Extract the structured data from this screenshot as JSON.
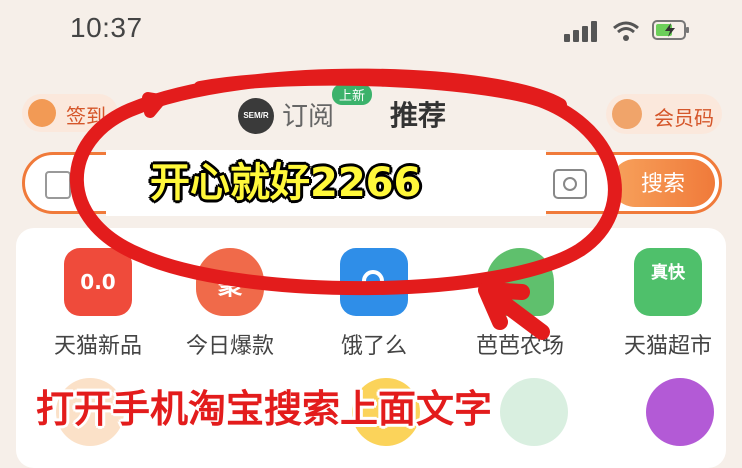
{
  "status_bar": {
    "time": "10:37"
  },
  "header": {
    "sign_in_label": "签到",
    "subscribe_tab": {
      "logo_text": "SEM/R",
      "label": "订阅",
      "badge": "上新"
    },
    "recommend_tab": "推荐",
    "member_code_label": "会员码"
  },
  "search": {
    "hint_overlay": "开心就好2266",
    "button_label": "搜索"
  },
  "quick_entries": [
    {
      "label": "天猫新品",
      "icon": "tmall-new-icon",
      "glyph": "0.0"
    },
    {
      "label": "今日爆款",
      "icon": "hot-deal-icon",
      "glyph": "聚"
    },
    {
      "label": "饿了么",
      "icon": "eleme-icon",
      "glyph": ""
    },
    {
      "label": "芭芭农场",
      "icon": "farm-icon",
      "glyph": ""
    },
    {
      "label": "天猫超市",
      "icon": "tmall-supermarket-icon",
      "glyph": "真快"
    }
  ],
  "caption": "打开手机淘宝搜索上面文字",
  "colors": {
    "accent": "#f07a3a",
    "annotation_red": "#e31c1c",
    "highlight_yellow": "#fff83b"
  }
}
